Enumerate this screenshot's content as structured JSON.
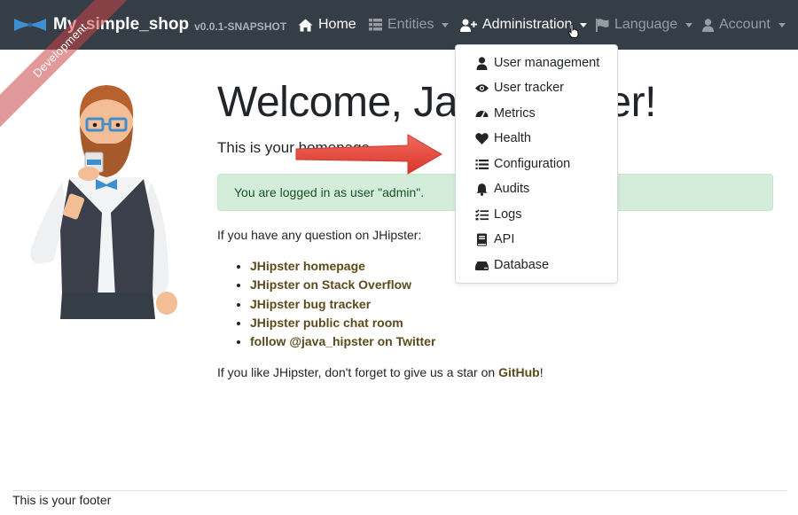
{
  "app": {
    "brand": "My_simple_shop",
    "version": "v0.0.1-SNAPSHOT",
    "ribbon": "Development"
  },
  "nav": {
    "home": "Home",
    "entities": "Entities",
    "administration": "Administration",
    "language": "Language",
    "account": "Account"
  },
  "admin_menu": {
    "items": [
      {
        "label": "User management",
        "icon": "user-icon"
      },
      {
        "label": "User tracker",
        "icon": "eye-icon"
      },
      {
        "label": "Metrics",
        "icon": "tachometer-icon"
      },
      {
        "label": "Health",
        "icon": "heart-icon"
      },
      {
        "label": "Configuration",
        "icon": "list-icon"
      },
      {
        "label": "Audits",
        "icon": "bell-icon"
      },
      {
        "label": "Logs",
        "icon": "tasks-icon"
      },
      {
        "label": "API",
        "icon": "book-icon"
      },
      {
        "label": "Database",
        "icon": "hdd-icon"
      }
    ]
  },
  "main": {
    "welcome": "Welcome, Java Hipster!",
    "homepage_text": "This is your homepage",
    "logged_in": "You are logged in as user \"admin\".",
    "question": "If you have any question on JHipster:",
    "links": [
      "JHipster homepage",
      "JHipster on Stack Overflow",
      "JHipster bug tracker",
      "JHipster public chat room",
      "follow @java_hipster on Twitter"
    ],
    "star_prefix": "If you like JHipster, don't forget to give us a star on ",
    "star_link": "GitHub",
    "star_suffix": "!"
  },
  "footer": {
    "text": "This is your footer"
  },
  "colors": {
    "navbar": "#353d47",
    "alert_bg": "#d4edda",
    "alert_text": "#155724",
    "link": "#5b4a1a",
    "arrow": "#e8463c"
  }
}
